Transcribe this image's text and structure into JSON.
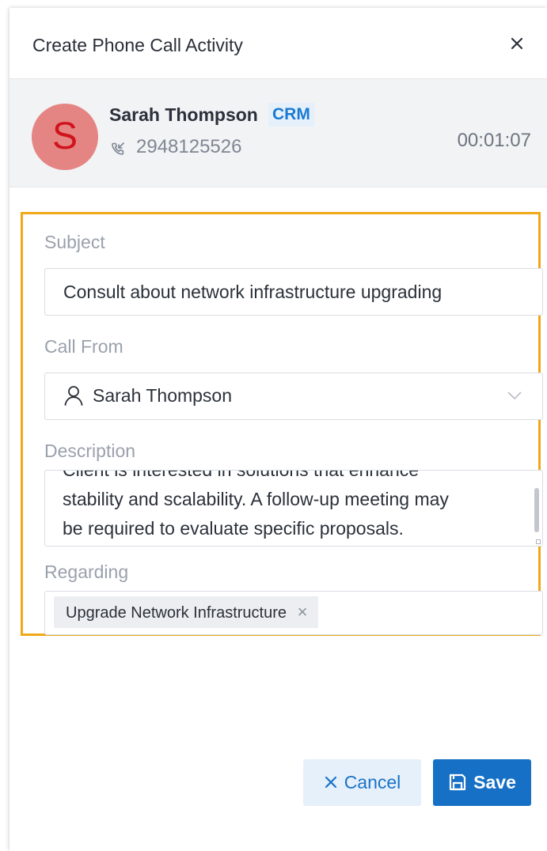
{
  "dialog": {
    "title": "Create Phone Call Activity",
    "close_icon": "close-icon"
  },
  "contact": {
    "avatar_initial": "S",
    "name": "Sarah Thompson",
    "badge": "CRM",
    "phone_icon": "incoming-call-icon",
    "phone": "2948125526",
    "duration": "00:01:07"
  },
  "form": {
    "subject": {
      "label": "Subject",
      "value": "Consult about network infrastructure upgrading"
    },
    "call_from": {
      "label": "Call From",
      "value": "Sarah Thompson",
      "icon": "user-icon"
    },
    "description": {
      "label": "Description",
      "line_1": "Client is interested in solutions that enhance",
      "line_2": "stability and scalability. A follow-up meeting may",
      "line_3": "be required to evaluate specific proposals."
    },
    "regarding": {
      "label": "Regarding",
      "tag": "Upgrade Network Infrastructure",
      "tag_remove": "×"
    }
  },
  "actions": {
    "cancel_label": "Cancel",
    "save_label": "Save"
  },
  "colors": {
    "highlight_border": "#f0a818",
    "primary": "#1670c5",
    "avatar_bg": "#e58583",
    "avatar_text": "#d0131d"
  }
}
